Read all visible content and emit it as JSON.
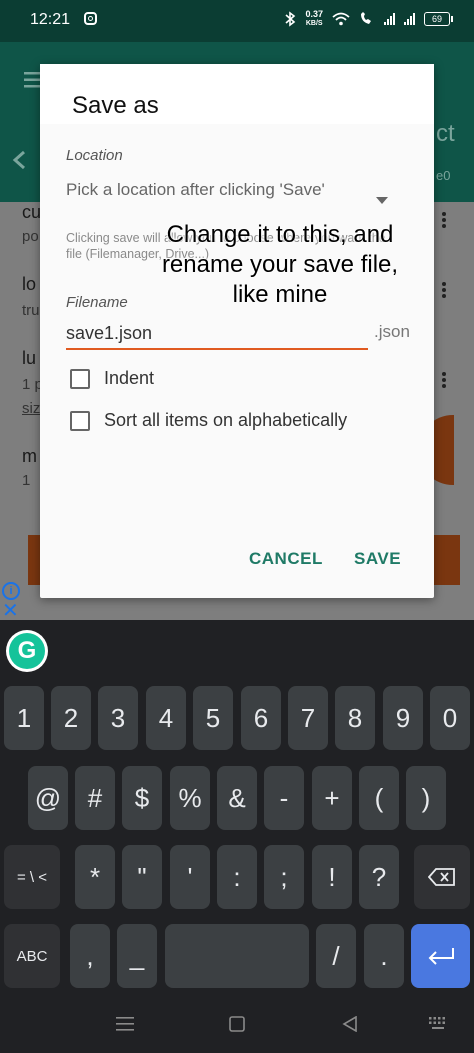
{
  "status_bar": {
    "time": "12:21",
    "speed_value": "0.37",
    "speed_unit": "KB/S",
    "battery": "69"
  },
  "background": {
    "items": [
      {
        "title": "cu",
        "subtitle": "po"
      },
      {
        "title": "lo",
        "subtitle": "tru"
      },
      {
        "title": "lu",
        "subtitle": "1 p",
        "extra": "siz"
      },
      {
        "title": "m",
        "subtitle": "1"
      }
    ],
    "header_partial": "ct",
    "header_sub_partial": "e0"
  },
  "dialog": {
    "title": "Save as",
    "location_label": "Location",
    "location_value": "Pick a location after clicking 'Save'",
    "location_hint": "Clicking save will allow you to choose where you want the file (Filemanager, Drive...)",
    "filename_label": "Filename",
    "filename_value": "save1.json",
    "extension": ".json",
    "option_indent": "Indent",
    "option_sort": "Sort all items on alphabetically",
    "cancel_label": "CANCEL",
    "save_label": "SAVE"
  },
  "annotation": {
    "text": "Change it to this, and rename your save file, like mine"
  },
  "keyboard": {
    "grammarly_letter": "G",
    "row1": [
      "1",
      "2",
      "3",
      "4",
      "5",
      "6",
      "7",
      "8",
      "9",
      "0"
    ],
    "row2": [
      "@",
      "#",
      "$",
      "%",
      "&",
      "-",
      "+",
      "(",
      ")"
    ],
    "row3_left": "= \\ <",
    "row3": [
      "*",
      "\"",
      "'",
      ":",
      ";",
      "!",
      "?"
    ],
    "row4_left": "ABC",
    "row4_comma": ",",
    "row4_underscore": "_",
    "row4_slash": "/",
    "row4_dot": "."
  },
  "colors": {
    "accent": "#1f7a66",
    "input_underline": "#e05a20",
    "enter_key": "#4a78e0"
  }
}
